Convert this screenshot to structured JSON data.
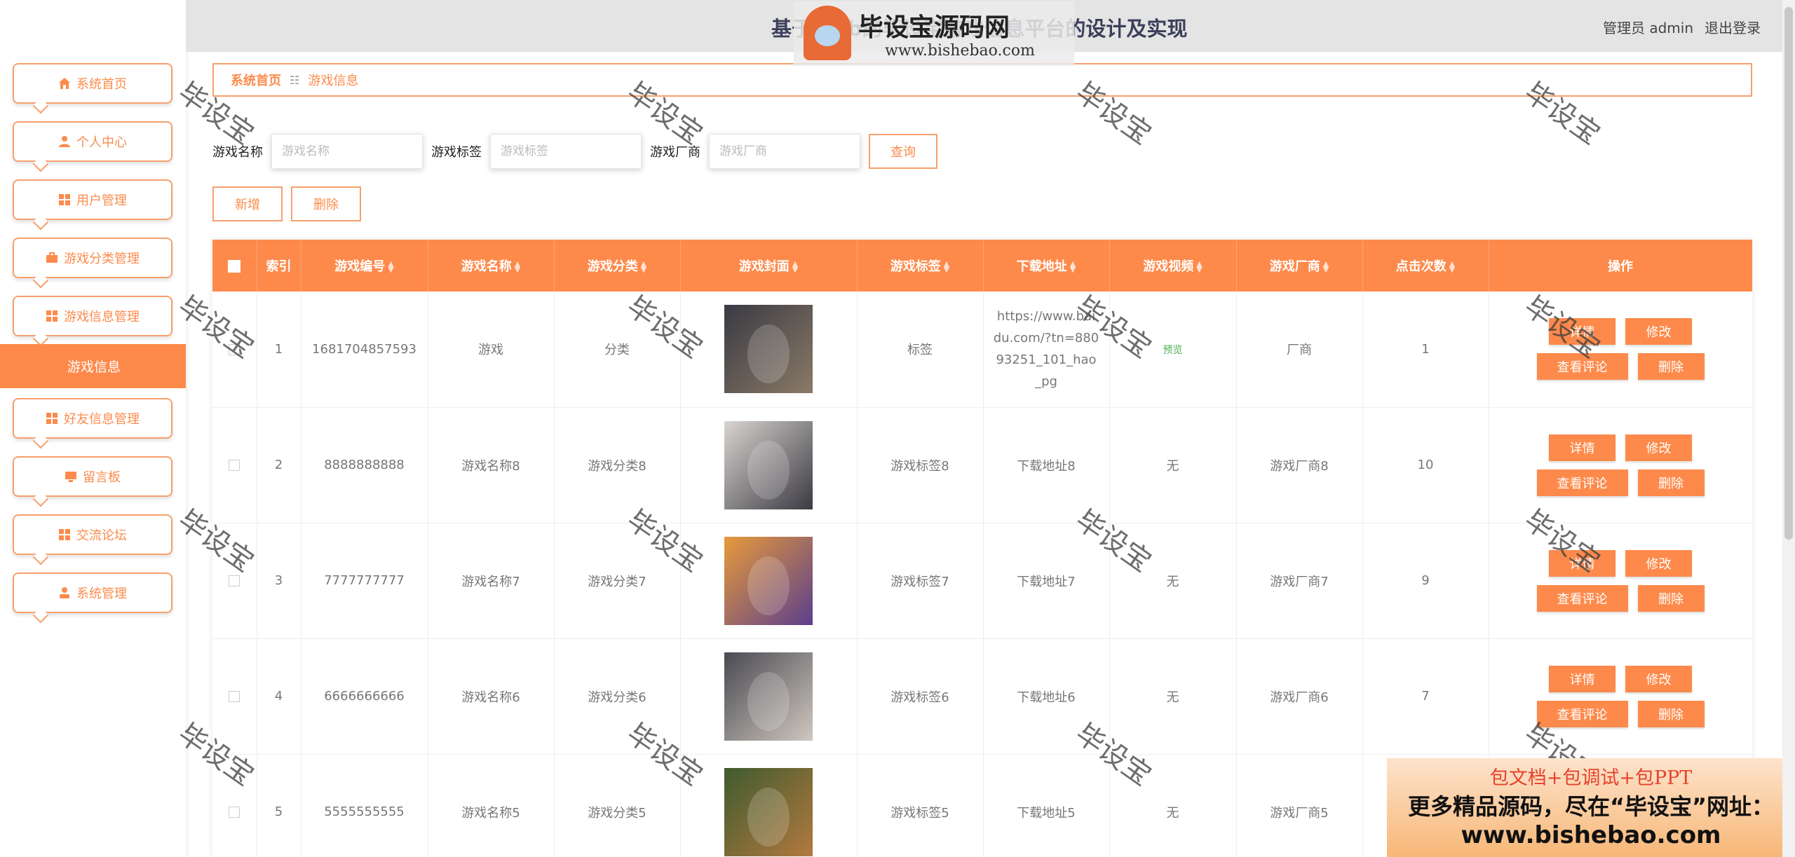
{
  "header": {
    "title": "基于Web的毕设宝游戏信息平台的设计及实现",
    "user_label": "管理员 admin",
    "logout": "退出登录"
  },
  "sidebar": {
    "items": [
      {
        "label": "系统首页",
        "icon": "home-icon"
      },
      {
        "label": "个人中心",
        "icon": "person-icon"
      },
      {
        "label": "用户管理",
        "icon": "grid-icon"
      },
      {
        "label": "游戏分类管理",
        "icon": "briefcase-icon"
      },
      {
        "label": "游戏信息管理",
        "icon": "grid-icon"
      },
      {
        "label": "好友信息管理",
        "icon": "grid-icon"
      },
      {
        "label": "留言板",
        "icon": "monitor-icon"
      },
      {
        "label": "交流论坛",
        "icon": "grid-icon"
      },
      {
        "label": "系统管理",
        "icon": "user-icon"
      }
    ],
    "active_sub": "游戏信息"
  },
  "breadcrumb": {
    "home": "系统首页",
    "separator": "☷",
    "current": "游戏信息"
  },
  "search": {
    "name_label": "游戏名称",
    "name_placeholder": "游戏名称",
    "tag_label": "游戏标签",
    "tag_placeholder": "游戏标签",
    "vendor_label": "游戏厂商",
    "vendor_placeholder": "游戏厂商",
    "query_button": "查询"
  },
  "actions": {
    "add": "新增",
    "delete": "删除"
  },
  "table": {
    "columns": [
      "索引",
      "游戏编号",
      "游戏名称",
      "游戏分类",
      "游戏封面",
      "游戏标签",
      "下载地址",
      "游戏视频",
      "游戏厂商",
      "点击次数",
      "操作"
    ],
    "row_buttons": {
      "detail": "详情",
      "edit": "修改",
      "comments": "查看评论",
      "delete": "删除"
    },
    "rows": [
      {
        "index": "1",
        "id": "1681704857593",
        "name": "游戏",
        "category": "分类",
        "tag": "标签",
        "url": "https://www.baidu.com/?tn=88093251_101_hao_pg",
        "video": "预览",
        "vendor": "厂商",
        "clicks": "1"
      },
      {
        "index": "2",
        "id": "8888888888",
        "name": "游戏名称8",
        "category": "游戏分类8",
        "tag": "游戏标签8",
        "url": "下载地址8",
        "video": "无",
        "vendor": "游戏厂商8",
        "clicks": "10"
      },
      {
        "index": "3",
        "id": "7777777777",
        "name": "游戏名称7",
        "category": "游戏分类7",
        "tag": "游戏标签7",
        "url": "下载地址7",
        "video": "无",
        "vendor": "游戏厂商7",
        "clicks": "9"
      },
      {
        "index": "4",
        "id": "6666666666",
        "name": "游戏名称6",
        "category": "游戏分类6",
        "tag": "游戏标签6",
        "url": "下载地址6",
        "video": "无",
        "vendor": "游戏厂商6",
        "clicks": "7"
      },
      {
        "index": "5",
        "id": "5555555555",
        "name": "游戏名称5",
        "category": "游戏分类5",
        "tag": "游戏标签5",
        "url": "下载地址5",
        "video": "无",
        "vendor": "游戏厂商5",
        "clicks": ""
      }
    ]
  },
  "watermark": {
    "text": "毕设宝",
    "logo_title": "毕设宝源码网",
    "logo_url": "www.bishebao.com"
  },
  "promo": {
    "line1": "包文档+包调试+包PPT",
    "line2": "更多精品源码，尽在“毕设宝”网址：",
    "line3": "www.bishebao.com"
  },
  "colors": {
    "accent": "#fd8a4b",
    "border": "#f7a06c"
  }
}
